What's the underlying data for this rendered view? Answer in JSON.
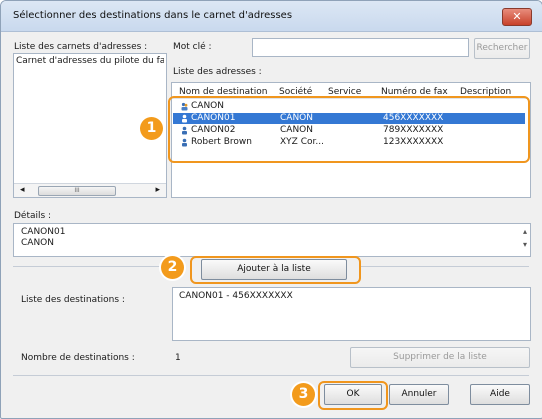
{
  "window": {
    "title": "Sélectionner des destinations dans le carnet d'adresses",
    "close_glyph": "✕"
  },
  "left": {
    "label": "Liste des carnets d'adresses :",
    "items": [
      "Carnet d'adresses du pilote du fax C"
    ],
    "scroll_left": "◂",
    "scroll_right": "▸",
    "scroll_thumb": "III"
  },
  "search": {
    "label": "Mot clé :",
    "value": "",
    "button": "Rechercher"
  },
  "addresses": {
    "label": "Liste des adresses :",
    "columns": [
      "Nom de destination",
      "Société",
      "Service",
      "Numéro de fax",
      "Description"
    ],
    "rows": [
      {
        "name": "CANON",
        "company": "",
        "service": "",
        "fax": "",
        "description": "",
        "icon": "group-icon",
        "selected": false
      },
      {
        "name": "CANON01",
        "company": "CANON",
        "service": "",
        "fax": "456XXXXXXX",
        "description": "",
        "icon": "person-icon",
        "selected": true
      },
      {
        "name": "CANON02",
        "company": "CANON",
        "service": "",
        "fax": "789XXXXXXX",
        "description": "",
        "icon": "person-icon",
        "selected": false
      },
      {
        "name": "Robert Brown",
        "company": "XYZ Cor...",
        "service": "",
        "fax": "123XXXXXXX",
        "description": "",
        "icon": "person-icon",
        "selected": false
      }
    ]
  },
  "details": {
    "label": "Détails :",
    "line1": "CANON01",
    "line2": "CANON",
    "scroll_up": "▴",
    "scroll_down": "▾"
  },
  "add_button": "Ajouter à la liste",
  "destinations": {
    "label": "Liste des destinations :",
    "items": [
      "CANON01 - 456XXXXXXX"
    ]
  },
  "count": {
    "label": "Nombre de destinations :",
    "value": "1"
  },
  "remove_button": "Supprimer de la liste",
  "buttons": {
    "ok": "OK",
    "cancel": "Annuler",
    "help": "Aide"
  },
  "callouts": [
    "1",
    "2",
    "3"
  ],
  "colors": {
    "callout": "#f39b1c",
    "selection": "#3478d4"
  }
}
